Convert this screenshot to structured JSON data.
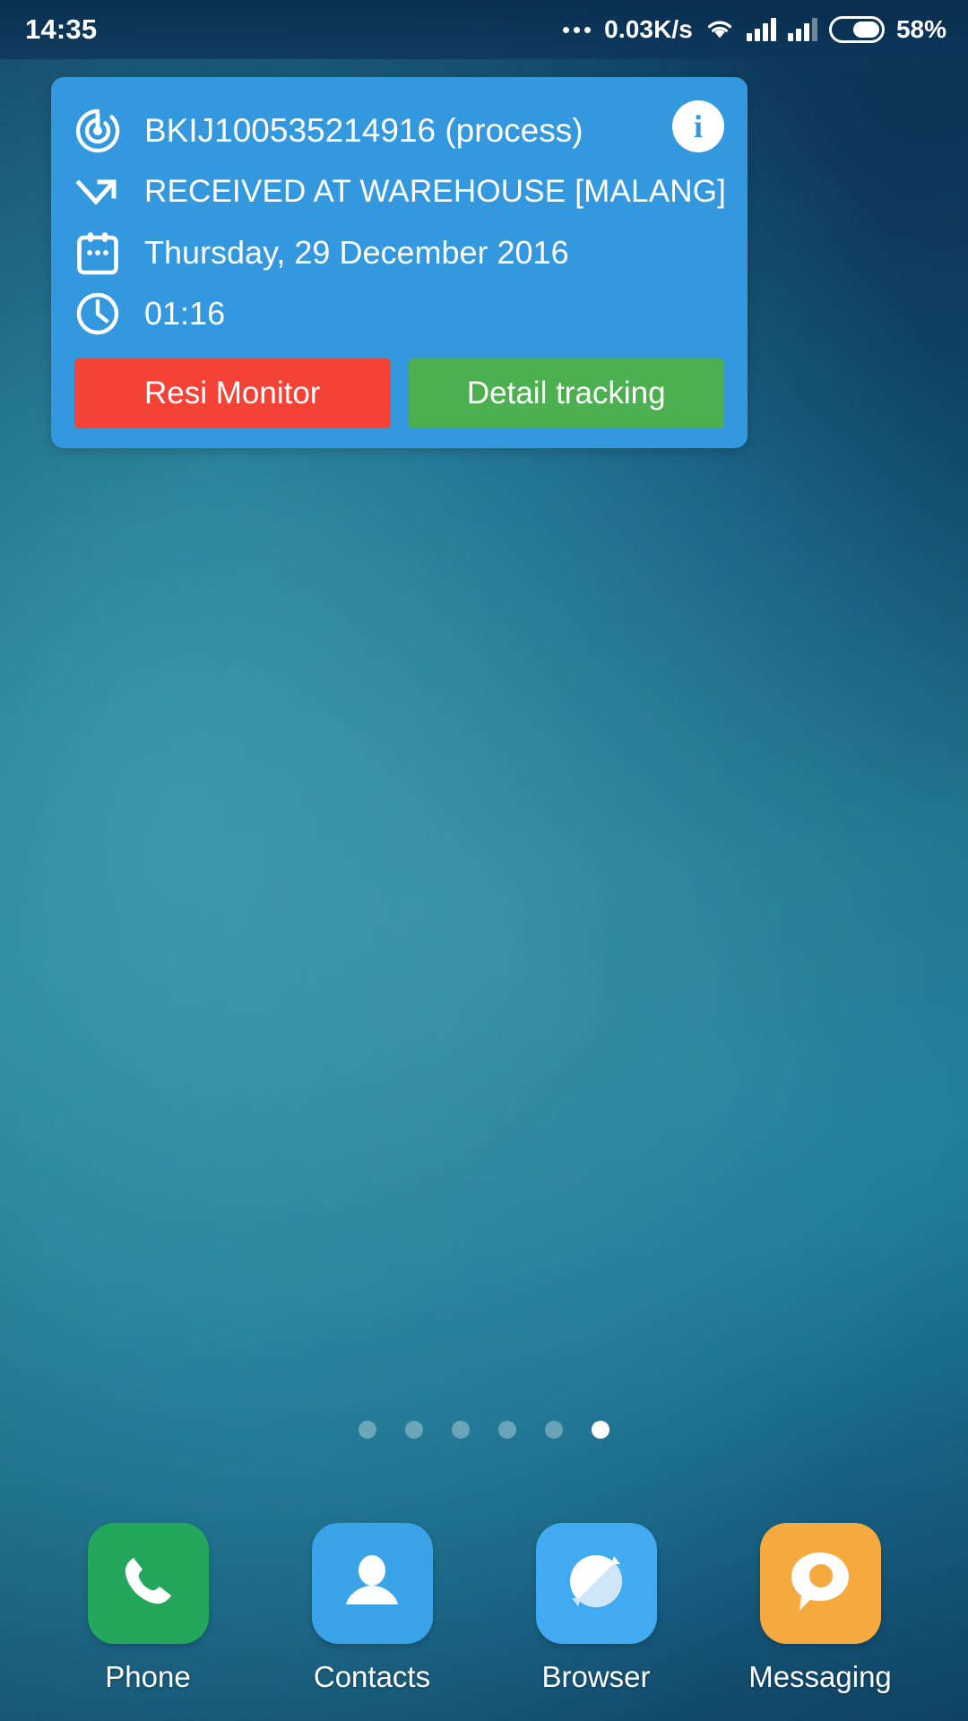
{
  "status_bar": {
    "clock": "14:35",
    "net_speed": "0.03K/s",
    "battery_percent": "58%",
    "battery_level": 58,
    "icons": [
      "more-dots-icon",
      "wifi-icon",
      "signal-icon-1",
      "signal-icon-2",
      "battery-icon"
    ]
  },
  "widget": {
    "tracking_number": "BKIJ100535214916 (process)",
    "status": "RECEIVED AT WAREHOUSE [MALANG]",
    "date": "Thursday, 29 December 2016",
    "time": "01:16",
    "info_label": "i",
    "buttons": {
      "resi_monitor": "Resi Monitor",
      "detail_tracking": "Detail tracking"
    },
    "colors": {
      "card": "#3398dd",
      "resi_monitor": "#f44336",
      "detail_tracking": "#4caf50",
      "text": "#ffffff"
    },
    "icons": [
      "radar-tracking-icon",
      "zigzag-arrow-icon",
      "calendar-icon",
      "clock-icon",
      "info-icon"
    ]
  },
  "home_screen": {
    "page_dots": {
      "count": 6,
      "active_index": 5
    },
    "dock": [
      {
        "label": "Phone",
        "icon": "phone-icon",
        "color": "#22a75d"
      },
      {
        "label": "Contacts",
        "icon": "contacts-icon",
        "color": "#3ba3e8"
      },
      {
        "label": "Browser",
        "icon": "browser-icon",
        "color": "#41aaf0"
      },
      {
        "label": "Messaging",
        "icon": "messaging-icon",
        "color": "#f5a93f"
      }
    ]
  }
}
